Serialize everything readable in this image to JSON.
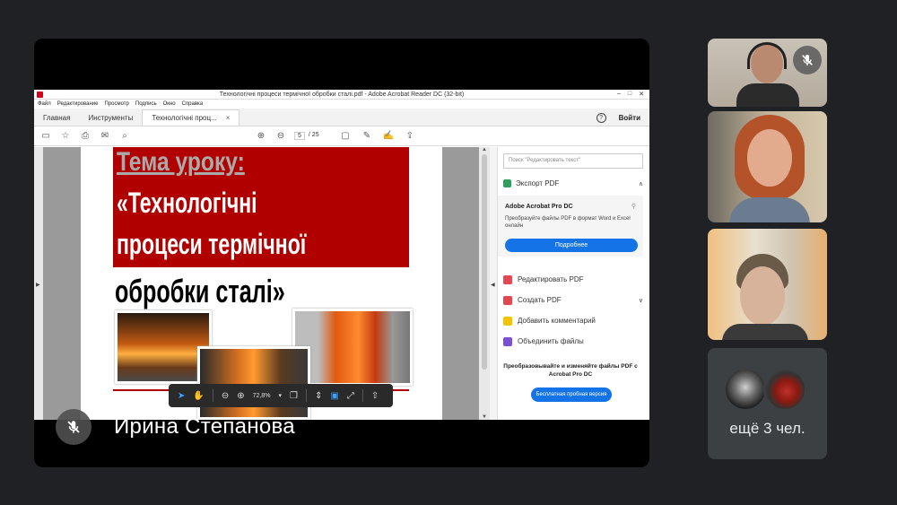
{
  "acrobat": {
    "window_title": "Технологічні процеси термічної обробки сталі.pdf - Adobe Acrobat Reader DC (32-bit)",
    "window_buttons": [
      "–",
      "□",
      "✕"
    ],
    "menu": [
      "Файл",
      "Редактирование",
      "Просмотр",
      "Подпись",
      "Окно",
      "Справка"
    ],
    "tabs": {
      "home": "Главная",
      "tools": "Инструменты",
      "document": "Технологічні проц...",
      "close": "×"
    },
    "help": "?",
    "sign_in": "Войти",
    "toolbar": {
      "page_current": "5",
      "page_total": "/ 25"
    },
    "slide": {
      "title_line1": "Тема уроку:",
      "title_line2": "«Технологічні",
      "title_line3": "процеси термічної",
      "title_line4": "обробки сталі»"
    },
    "float_toolbar": {
      "zoom": "72,8%",
      "zoom_caret": "▾"
    },
    "pane": {
      "search_placeholder": "Поиск \"Редактировать текст\"",
      "export_label": "Экспорт PDF",
      "acro_title": "Adobe Acrobat Pro DC",
      "acro_desc": "Преобразуйте файлы PDF в формат Word и Excel онлайн",
      "more_button": "Подробнее",
      "tools": [
        {
          "label": "Редактировать PDF",
          "color": "#e34850"
        },
        {
          "label": "Создать PDF",
          "color": "#e34850"
        },
        {
          "label": "Добавить комментарий",
          "color": "#f5c400"
        },
        {
          "label": "Объединить файлы",
          "color": "#7b4fd6"
        }
      ],
      "promo": "Преобразовывайте и изменяйте файлы PDF с Acrobat Pro DC",
      "trial_button": "Бесплатная пробная версия"
    }
  },
  "meeting": {
    "presenter_name": "Ирина Степанова",
    "others_count": "ещё 3 чел.",
    "accent_blue": "#1473e6",
    "muted_icon": "mic-off-icon"
  }
}
